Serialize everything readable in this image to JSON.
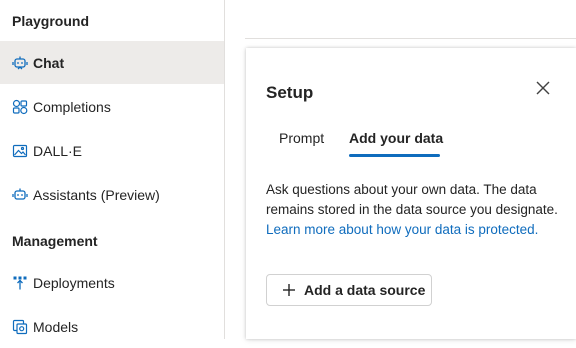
{
  "sidebar": {
    "playground_title": "Playground",
    "playground_items": [
      {
        "label": "Chat",
        "icon": "chat-bot-icon"
      },
      {
        "label": "Completions",
        "icon": "completions-icon"
      },
      {
        "label": "DALL·E",
        "icon": "image-icon"
      },
      {
        "label": "Assistants (Preview)",
        "icon": "assistant-bot-icon"
      }
    ],
    "management_title": "Management",
    "management_items": [
      {
        "label": "Deployments",
        "icon": "deployments-icon"
      },
      {
        "label": "Models",
        "icon": "models-icon"
      }
    ]
  },
  "panel": {
    "title": "Setup",
    "close_icon": "close-icon",
    "tabs": [
      {
        "label": "Prompt",
        "active": false
      },
      {
        "label": "Add your data",
        "active": true
      }
    ],
    "description": "Ask questions about your own data. The data remains stored in the data source you designate. ",
    "learn_more_link": "Learn more about how your data is protected.",
    "add_button_label": "Add a data source",
    "add_button_icon": "plus-icon"
  },
  "colors": {
    "accent": "#0f6cbd",
    "selected_bg": "#edebe9",
    "divider": "#e1dfdd"
  }
}
